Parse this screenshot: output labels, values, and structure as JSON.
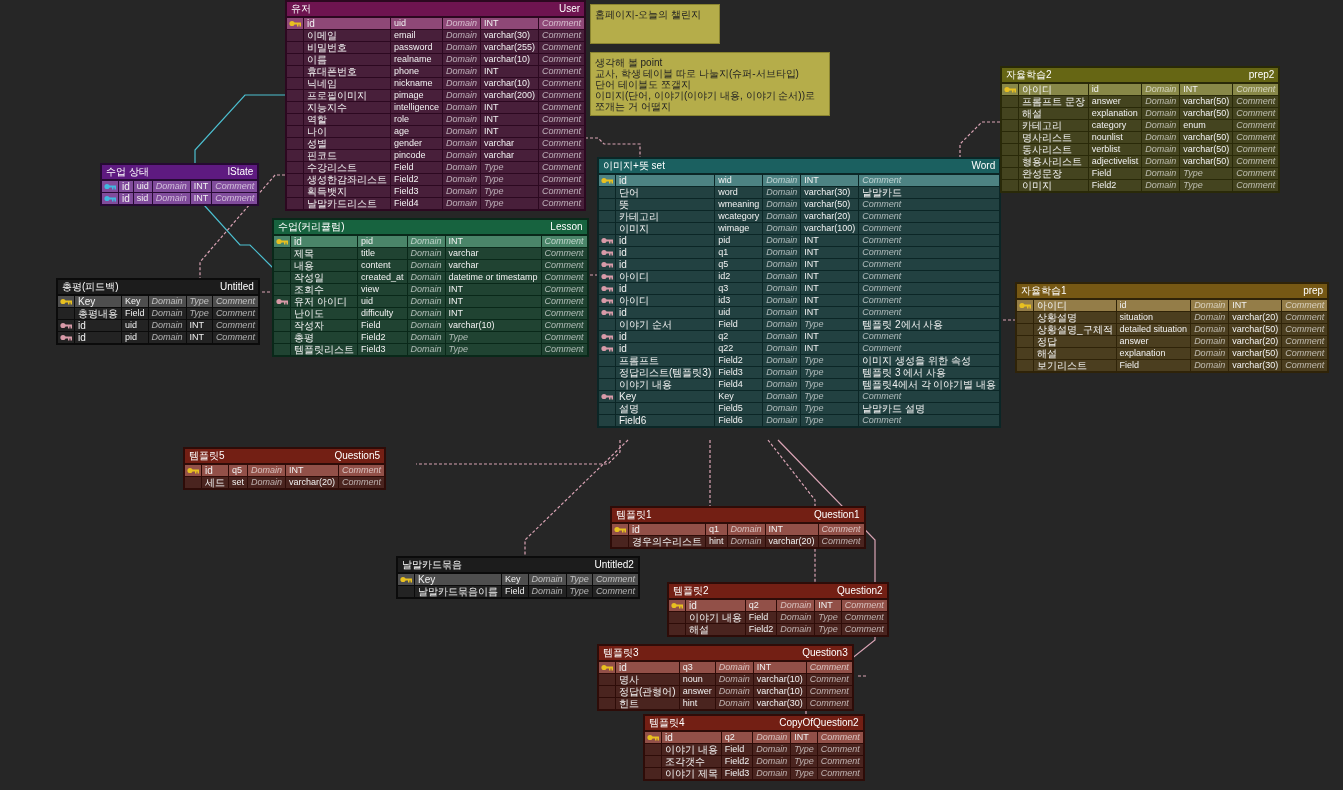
{
  "notes": [
    {
      "text": "홈페이지-오늘의 챌린지"
    },
    {
      "text": "생각해 볼 point\n교사, 학생 테이블 따로 나눌지(슈퍼-서브타입)\n단어 테이블도 쪼갤지\n이미지(단어, 이야기(이야기 내용, 이야기 순서))로 쪼개는 거 어떨지"
    }
  ],
  "tables": [
    {
      "title": "유저",
      "name": "User",
      "color": "#6e1450",
      "rows": [
        {
          "kind": "pk",
          "cells": [
            "id",
            "uid",
            {
              "placeholder": "Domain"
            },
            "INT",
            {
              "placeholder": "Comment"
            }
          ]
        },
        {
          "kind": "none",
          "cells": [
            "이메일",
            "email",
            {
              "placeholder": "Domain"
            },
            "varchar(30)",
            {
              "placeholder": "Comment"
            }
          ]
        },
        {
          "kind": "none",
          "cells": [
            "비밀번호",
            "password",
            {
              "placeholder": "Domain"
            },
            "varchar(255)",
            {
              "placeholder": "Comment"
            }
          ]
        },
        {
          "kind": "none",
          "cells": [
            "이름",
            "realname",
            {
              "placeholder": "Domain"
            },
            "varchar(10)",
            {
              "placeholder": "Comment"
            }
          ]
        },
        {
          "kind": "none",
          "cells": [
            "휴대폰번호",
            "phone",
            {
              "placeholder": "Domain"
            },
            "INT",
            {
              "placeholder": "Comment"
            }
          ]
        },
        {
          "kind": "none",
          "cells": [
            "닉네임",
            "nickname",
            {
              "placeholder": "Domain"
            },
            "varchar(10)",
            {
              "placeholder": "Comment"
            }
          ]
        },
        {
          "kind": "none",
          "cells": [
            "프로필이미지",
            "pimage",
            {
              "placeholder": "Domain"
            },
            "varchar(200)",
            {
              "placeholder": "Comment"
            }
          ]
        },
        {
          "kind": "none",
          "cells": [
            "지능지수",
            "intelligence",
            {
              "placeholder": "Domain"
            },
            "INT",
            {
              "placeholder": "Comment"
            }
          ]
        },
        {
          "kind": "none",
          "cells": [
            "역할",
            "role",
            {
              "placeholder": "Domain"
            },
            "INT",
            {
              "placeholder": "Comment"
            }
          ]
        },
        {
          "kind": "none",
          "cells": [
            "나이",
            "age",
            {
              "placeholder": "Domain"
            },
            "INT",
            {
              "placeholder": "Comment"
            }
          ]
        },
        {
          "kind": "none",
          "cells": [
            "성별",
            "gender",
            {
              "placeholder": "Domain"
            },
            "varchar",
            {
              "placeholder": "Comment"
            }
          ]
        },
        {
          "kind": "none",
          "cells": [
            "핀코드",
            "pincode",
            {
              "placeholder": "Domain"
            },
            "varchar",
            {
              "placeholder": "Comment"
            }
          ]
        },
        {
          "kind": "none",
          "cells": [
            "수강리스트",
            "Field",
            {
              "placeholder": "Domain"
            },
            {
              "placeholder": "Type"
            },
            {
              "placeholder": "Comment"
            }
          ]
        },
        {
          "kind": "none",
          "cells": [
            "생성한감좌리스트",
            "Field2",
            {
              "placeholder": "Domain"
            },
            {
              "placeholder": "Type"
            },
            {
              "placeholder": "Comment"
            }
          ]
        },
        {
          "kind": "none",
          "cells": [
            "획득뱃지",
            "Field3",
            {
              "placeholder": "Domain"
            },
            {
              "placeholder": "Type"
            },
            {
              "placeholder": "Comment"
            }
          ]
        },
        {
          "kind": "none",
          "cells": [
            "날말카드리스트",
            "Field4",
            {
              "placeholder": "Domain"
            },
            {
              "placeholder": "Type"
            },
            {
              "placeholder": "Comment"
            }
          ]
        }
      ]
    },
    {
      "title": "수업 상태",
      "name": "lState",
      "color": "#5e1a80",
      "rows": [
        {
          "kind": "pfk",
          "cells": [
            "id",
            "uid",
            {
              "placeholder": "Domain"
            },
            "INT",
            {
              "placeholder": "Comment"
            }
          ]
        },
        {
          "kind": "pfk",
          "cells": [
            "id",
            "sid",
            {
              "placeholder": "Domain"
            },
            "INT",
            {
              "placeholder": "Comment"
            }
          ]
        }
      ]
    },
    {
      "title": "수업(커리큘럼)",
      "name": "Lesson",
      "color": "#17633f",
      "rows": [
        {
          "kind": "pk",
          "cells": [
            "id",
            "pid",
            {
              "placeholder": "Domain"
            },
            "INT",
            {
              "placeholder": "Comment"
            }
          ]
        },
        {
          "kind": "none",
          "cells": [
            "제목",
            "title",
            {
              "placeholder": "Domain"
            },
            "varchar",
            {
              "placeholder": "Comment"
            }
          ]
        },
        {
          "kind": "none",
          "cells": [
            "내용",
            "content",
            {
              "placeholder": "Domain"
            },
            "varchar",
            {
              "placeholder": "Comment"
            }
          ]
        },
        {
          "kind": "none",
          "cells": [
            "작성일",
            "created_at",
            {
              "placeholder": "Domain"
            },
            "datetime or timestamp",
            {
              "placeholder": "Comment"
            }
          ]
        },
        {
          "kind": "none",
          "cells": [
            "조회수",
            "view",
            {
              "placeholder": "Domain"
            },
            "INT",
            {
              "placeholder": "Comment"
            }
          ]
        },
        {
          "kind": "fk",
          "cells": [
            "유저 아이디",
            "uid",
            {
              "placeholder": "Domain"
            },
            "INT",
            {
              "placeholder": "Comment"
            }
          ]
        },
        {
          "kind": "none",
          "cells": [
            "난이도",
            "difficulty",
            {
              "placeholder": "Domain"
            },
            "INT",
            {
              "placeholder": "Comment"
            }
          ]
        },
        {
          "kind": "none",
          "cells": [
            "작성자",
            "Field",
            {
              "placeholder": "Domain"
            },
            "varchar(10)",
            {
              "placeholder": "Comment"
            }
          ]
        },
        {
          "kind": "none",
          "cells": [
            "총평",
            "Field2",
            {
              "placeholder": "Domain"
            },
            {
              "placeholder": "Type"
            },
            {
              "placeholder": "Comment"
            }
          ]
        },
        {
          "kind": "none",
          "cells": [
            "템플릿리스트",
            "Field3",
            {
              "placeholder": "Domain"
            },
            {
              "placeholder": "Type"
            },
            {
              "placeholder": "Comment"
            }
          ]
        }
      ]
    },
    {
      "title": "총평(피드백)",
      "name": "Untitled",
      "color": "#1c1c1c",
      "rows": [
        {
          "kind": "pk",
          "cells": [
            "Key",
            "Key",
            {
              "placeholder": "Domain"
            },
            {
              "placeholder": "Type"
            },
            {
              "placeholder": "Comment"
            }
          ]
        },
        {
          "kind": "none",
          "cells": [
            "총평내용",
            "Field",
            {
              "placeholder": "Domain"
            },
            {
              "placeholder": "Type"
            },
            {
              "placeholder": "Comment"
            }
          ]
        },
        {
          "kind": "fk",
          "cells": [
            "id",
            "uid",
            {
              "placeholder": "Domain"
            },
            "INT",
            {
              "placeholder": "Comment"
            }
          ]
        },
        {
          "kind": "fk",
          "cells": [
            "id",
            "pid",
            {
              "placeholder": "Domain"
            },
            "INT",
            {
              "placeholder": "Comment"
            }
          ]
        }
      ]
    },
    {
      "title": "이미지+뜻 set",
      "name": "Word",
      "color": "#1b6060",
      "rows": [
        {
          "kind": "pk",
          "cells": [
            "id",
            "wid",
            {
              "placeholder": "Domain"
            },
            "INT",
            {
              "placeholder": "Comment"
            }
          ]
        },
        {
          "kind": "none",
          "cells": [
            "단어",
            "word",
            {
              "placeholder": "Domain"
            },
            "varchar(30)",
            "낱말카드"
          ]
        },
        {
          "kind": "none",
          "cells": [
            "뜻",
            "wmeaning",
            {
              "placeholder": "Domain"
            },
            "varchar(50)",
            {
              "placeholder": "Comment"
            }
          ]
        },
        {
          "kind": "none",
          "cells": [
            "카테고리",
            "wcategory",
            {
              "placeholder": "Domain"
            },
            "varchar(20)",
            {
              "placeholder": "Comment"
            }
          ]
        },
        {
          "kind": "none",
          "cells": [
            "이미지",
            "wimage",
            {
              "placeholder": "Domain"
            },
            "varchar(100)",
            {
              "placeholder": "Comment"
            }
          ]
        },
        {
          "kind": "fk",
          "cells": [
            "id",
            "pid",
            {
              "placeholder": "Domain"
            },
            "INT",
            {
              "placeholder": "Comment"
            }
          ]
        },
        {
          "kind": "fk",
          "cells": [
            "id",
            "q1",
            {
              "placeholder": "Domain"
            },
            "INT",
            {
              "placeholder": "Comment"
            }
          ]
        },
        {
          "kind": "fk",
          "cells": [
            "id",
            "q5",
            {
              "placeholder": "Domain"
            },
            "INT",
            {
              "placeholder": "Comment"
            }
          ]
        },
        {
          "kind": "fk",
          "cells": [
            "아이디",
            "id2",
            {
              "placeholder": "Domain"
            },
            "INT",
            {
              "placeholder": "Comment"
            }
          ]
        },
        {
          "kind": "fk",
          "cells": [
            "id",
            "q3",
            {
              "placeholder": "Domain"
            },
            "INT",
            {
              "placeholder": "Comment"
            }
          ]
        },
        {
          "kind": "fk",
          "cells": [
            "아이디",
            "id3",
            {
              "placeholder": "Domain"
            },
            "INT",
            {
              "placeholder": "Comment"
            }
          ]
        },
        {
          "kind": "fk",
          "cells": [
            "id",
            "uid",
            {
              "placeholder": "Domain"
            },
            "INT",
            {
              "placeholder": "Comment"
            }
          ]
        },
        {
          "kind": "none",
          "cells": [
            "이야기 순서",
            "Field",
            {
              "placeholder": "Domain"
            },
            {
              "placeholder": "Type"
            },
            "템플릿 2에서 사용"
          ]
        },
        {
          "kind": "fk",
          "cells": [
            "id",
            "q2",
            {
              "placeholder": "Domain"
            },
            "INT",
            {
              "placeholder": "Comment"
            }
          ]
        },
        {
          "kind": "fk",
          "cells": [
            "id",
            "q22",
            {
              "placeholder": "Domain"
            },
            "INT",
            {
              "placeholder": "Comment"
            }
          ]
        },
        {
          "kind": "none",
          "cells": [
            "프롬프트",
            "Field2",
            {
              "placeholder": "Domain"
            },
            {
              "placeholder": "Type"
            },
            "이미지 생성을 위한 속성"
          ]
        },
        {
          "kind": "none",
          "cells": [
            "정답리스트(템플릿3)",
            "Field3",
            {
              "placeholder": "Domain"
            },
            {
              "placeholder": "Type"
            },
            "템플릿 3 에서 사용"
          ]
        },
        {
          "kind": "none",
          "cells": [
            "이야기 내용",
            "Field4",
            {
              "placeholder": "Domain"
            },
            {
              "placeholder": "Type"
            },
            "템플릿4에서 각 이야기별 내용"
          ]
        },
        {
          "kind": "fk",
          "cells": [
            "Key",
            "Key",
            {
              "placeholder": "Domain"
            },
            {
              "placeholder": "Type"
            },
            {
              "placeholder": "Comment"
            }
          ]
        },
        {
          "kind": "none",
          "cells": [
            "설명",
            "Field5",
            {
              "placeholder": "Domain"
            },
            {
              "placeholder": "Type"
            },
            "낱말카드 설명"
          ]
        },
        {
          "kind": "none",
          "cells": [
            "Field6",
            "Field6",
            {
              "placeholder": "Domain"
            },
            {
              "placeholder": "Type"
            },
            {
              "placeholder": "Comment"
            }
          ]
        }
      ]
    },
    {
      "title": "자율학습2",
      "name": "prep2",
      "color": "#666614",
      "rows": [
        {
          "kind": "pk",
          "cells": [
            "아이디",
            "id",
            {
              "placeholder": "Domain"
            },
            "INT",
            {
              "placeholder": "Comment"
            }
          ]
        },
        {
          "kind": "none",
          "cells": [
            "프롬프트 문장",
            "answer",
            {
              "placeholder": "Domain"
            },
            "varchar(50)",
            {
              "placeholder": "Comment"
            }
          ]
        },
        {
          "kind": "none",
          "cells": [
            "해설",
            "explanation",
            {
              "placeholder": "Domain"
            },
            "varchar(50)",
            {
              "placeholder": "Comment"
            }
          ]
        },
        {
          "kind": "none",
          "cells": [
            "카테고리",
            "category",
            {
              "placeholder": "Domain"
            },
            "enum",
            {
              "placeholder": "Comment"
            }
          ]
        },
        {
          "kind": "none",
          "cells": [
            "명사리스트",
            "nounlist",
            {
              "placeholder": "Domain"
            },
            "varchar(50)",
            {
              "placeholder": "Comment"
            }
          ]
        },
        {
          "kind": "none",
          "cells": [
            "동사리스트",
            "verblist",
            {
              "placeholder": "Domain"
            },
            "varchar(50)",
            {
              "placeholder": "Comment"
            }
          ]
        },
        {
          "kind": "none",
          "cells": [
            "형용사리스트",
            "adjectivelist",
            {
              "placeholder": "Domain"
            },
            "varchar(50)",
            {
              "placeholder": "Comment"
            }
          ]
        },
        {
          "kind": "none",
          "cells": [
            "완성문장",
            "Field",
            {
              "placeholder": "Domain"
            },
            {
              "placeholder": "Type"
            },
            {
              "placeholder": "Comment"
            }
          ]
        },
        {
          "kind": "none",
          "cells": [
            "이미지",
            "Field2",
            {
              "placeholder": "Domain"
            },
            {
              "placeholder": "Type"
            },
            {
              "placeholder": "Comment"
            }
          ]
        }
      ]
    },
    {
      "title": "자율학습1",
      "name": "prep",
      "color": "#765814",
      "rows": [
        {
          "kind": "pk",
          "cells": [
            "아이디",
            "id",
            {
              "placeholder": "Domain"
            },
            "INT",
            {
              "placeholder": "Comment"
            }
          ]
        },
        {
          "kind": "none",
          "cells": [
            "상황설명",
            "situation",
            {
              "placeholder": "Domain"
            },
            "varchar(20)",
            {
              "placeholder": "Comment"
            }
          ]
        },
        {
          "kind": "none",
          "cells": [
            "상황설명_구체적",
            "detailed situation",
            {
              "placeholder": "Domain"
            },
            "varchar(50)",
            {
              "placeholder": "Comment"
            }
          ]
        },
        {
          "kind": "none",
          "cells": [
            "정답",
            "answer",
            {
              "placeholder": "Domain"
            },
            "varchar(20)",
            {
              "placeholder": "Comment"
            }
          ]
        },
        {
          "kind": "none",
          "cells": [
            "해설",
            "explanation",
            {
              "placeholder": "Domain"
            },
            "varchar(50)",
            {
              "placeholder": "Comment"
            }
          ]
        },
        {
          "kind": "none",
          "cells": [
            "보기리스트",
            "Field",
            {
              "placeholder": "Domain"
            },
            "varchar(30)",
            {
              "placeholder": "Comment"
            }
          ]
        }
      ]
    },
    {
      "title": "템플릿5",
      "name": "Question5",
      "color": "#731f14",
      "rows": [
        {
          "kind": "pk",
          "cells": [
            "id",
            "q5",
            {
              "placeholder": "Domain"
            },
            "INT",
            {
              "placeholder": "Comment"
            }
          ]
        },
        {
          "kind": "none",
          "cells": [
            "세드",
            "set",
            {
              "placeholder": "Domain"
            },
            "varchar(20)",
            {
              "placeholder": "Comment"
            }
          ]
        }
      ]
    },
    {
      "title": "날말카드묶음",
      "name": "Untitled2",
      "color": "#1c1c1c",
      "rows": [
        {
          "kind": "pk",
          "cells": [
            "Key",
            "Key",
            {
              "placeholder": "Domain"
            },
            {
              "placeholder": "Type"
            },
            {
              "placeholder": "Comment"
            }
          ]
        },
        {
          "kind": "none",
          "cells": [
            "날말카드묶음이름",
            "Field",
            {
              "placeholder": "Domain"
            },
            {
              "placeholder": "Type"
            },
            {
              "placeholder": "Comment"
            }
          ]
        }
      ]
    },
    {
      "title": "템플릿1",
      "name": "Question1",
      "color": "#731f14",
      "rows": [
        {
          "kind": "pk",
          "cells": [
            "id",
            "q1",
            {
              "placeholder": "Domain"
            },
            "INT",
            {
              "placeholder": "Comment"
            }
          ]
        },
        {
          "kind": "none",
          "cells": [
            "경우의수리스트",
            "hint",
            {
              "placeholder": "Domain"
            },
            "varchar(20)",
            {
              "placeholder": "Comment"
            }
          ]
        }
      ]
    },
    {
      "title": "템플릿2",
      "name": "Question2",
      "color": "#731f14",
      "rows": [
        {
          "kind": "pk",
          "cells": [
            "id",
            "q2",
            {
              "placeholder": "Domain"
            },
            "INT",
            {
              "placeholder": "Comment"
            }
          ]
        },
        {
          "kind": "none",
          "cells": [
            "이야기 내용",
            "Field",
            {
              "placeholder": "Domain"
            },
            {
              "placeholder": "Type"
            },
            {
              "placeholder": "Comment"
            }
          ]
        },
        {
          "kind": "none",
          "cells": [
            "해설",
            "Field2",
            {
              "placeholder": "Domain"
            },
            {
              "placeholder": "Type"
            },
            {
              "placeholder": "Comment"
            }
          ]
        }
      ]
    },
    {
      "title": "템플릿3",
      "name": "Question3",
      "color": "#731f14",
      "rows": [
        {
          "kind": "pk",
          "cells": [
            "id",
            "q3",
            {
              "placeholder": "Domain"
            },
            "INT",
            {
              "placeholder": "Comment"
            }
          ]
        },
        {
          "kind": "none",
          "cells": [
            "명사",
            "noun",
            {
              "placeholder": "Domain"
            },
            "varchar(10)",
            {
              "placeholder": "Comment"
            }
          ]
        },
        {
          "kind": "none",
          "cells": [
            "정답(관형어)",
            "answer",
            {
              "placeholder": "Domain"
            },
            "varchar(10)",
            {
              "placeholder": "Comment"
            }
          ]
        },
        {
          "kind": "none",
          "cells": [
            "힌트",
            "hint",
            {
              "placeholder": "Domain"
            },
            "varchar(30)",
            {
              "placeholder": "Comment"
            }
          ]
        }
      ]
    },
    {
      "title": "템플릿4",
      "name": "CopyOfQuestion2",
      "color": "#731f14",
      "rows": [
        {
          "kind": "pk",
          "cells": [
            "id",
            "q2",
            {
              "placeholder": "Domain"
            },
            "INT",
            {
              "placeholder": "Comment"
            }
          ]
        },
        {
          "kind": "none",
          "cells": [
            "이야기 내용",
            "Field",
            {
              "placeholder": "Domain"
            },
            {
              "placeholder": "Type"
            },
            {
              "placeholder": "Comment"
            }
          ]
        },
        {
          "kind": "none",
          "cells": [
            "조각갯수",
            "Field2",
            {
              "placeholder": "Domain"
            },
            {
              "placeholder": "Type"
            },
            {
              "placeholder": "Comment"
            }
          ]
        },
        {
          "kind": "none",
          "cells": [
            "이야기 제목",
            "Field3",
            {
              "placeholder": "Domain"
            },
            {
              "placeholder": "Type"
            },
            {
              "placeholder": "Comment"
            }
          ]
        }
      ]
    }
  ]
}
